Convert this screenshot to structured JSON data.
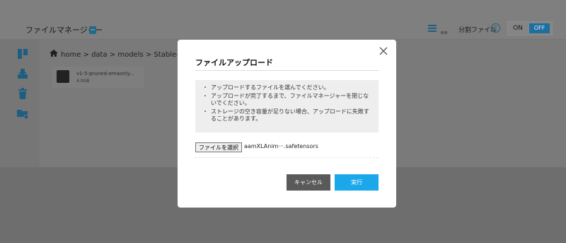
{
  "app": {
    "title": "ファイルマネージャー",
    "split_label": "分割ファイル",
    "help_glyph": "?",
    "toggle": {
      "on": "ON",
      "off": "OFF"
    }
  },
  "breadcrumb": {
    "text": "home  >  data  >  models  >  Stable-da"
  },
  "file": {
    "name": "v1-5-pruned-emaonly...",
    "size": "4.0GB"
  },
  "modal": {
    "title": "ファイルアップロード",
    "close_glyph": "×",
    "notes": [
      "アップロードするファイルを選んでください。",
      "アップロードが完了するまで、ファイルマネージャーを閉じないでください。",
      "ストレージの空き容量が足りない場合、アップロードに失敗することがあります。"
    ],
    "file_select_label": "ファイルを選択",
    "chosen_file": "aamXLAnim···.safetensors",
    "cancel_label": "キャンセル",
    "run_label": "実行"
  },
  "colors": {
    "accent": "#1ba8ea",
    "cancel": "#5a5a5a",
    "toggle_off": "#1e6fa0"
  }
}
